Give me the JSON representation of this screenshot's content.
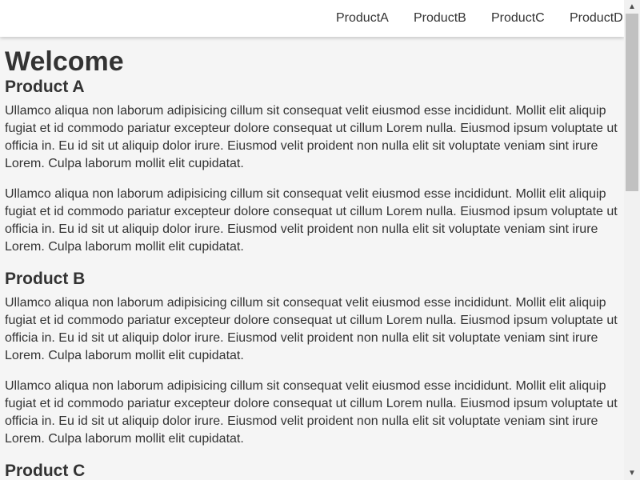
{
  "nav": {
    "links": [
      "ProductA",
      "ProductB",
      "ProductC",
      "ProductD"
    ]
  },
  "page": {
    "title": "Welcome"
  },
  "sections": [
    {
      "heading": "Product A",
      "paragraphs": [
        "Ullamco aliqua non laborum adipisicing cillum sit consequat velit eiusmod esse incididunt. Mollit elit aliquip fugiat et id commodo pariatur excepteur dolore consequat ut cillum Lorem nulla. Eiusmod ipsum voluptate ut officia in. Eu id sit ut aliquip dolor irure. Eiusmod velit proident non nulla elit sit voluptate veniam sint irure Lorem. Culpa laborum mollit elit cupidatat.",
        "Ullamco aliqua non laborum adipisicing cillum sit consequat velit eiusmod esse incididunt. Mollit elit aliquip fugiat et id commodo pariatur excepteur dolore consequat ut cillum Lorem nulla. Eiusmod ipsum voluptate ut officia in. Eu id sit ut aliquip dolor irure. Eiusmod velit proident non nulla elit sit voluptate veniam sint irure Lorem. Culpa laborum mollit elit cupidatat."
      ]
    },
    {
      "heading": "Product B",
      "paragraphs": [
        "Ullamco aliqua non laborum adipisicing cillum sit consequat velit eiusmod esse incididunt. Mollit elit aliquip fugiat et id commodo pariatur excepteur dolore consequat ut cillum Lorem nulla. Eiusmod ipsum voluptate ut officia in. Eu id sit ut aliquip dolor irure. Eiusmod velit proident non nulla elit sit voluptate veniam sint irure Lorem. Culpa laborum mollit elit cupidatat.",
        "Ullamco aliqua non laborum adipisicing cillum sit consequat velit eiusmod esse incididunt. Mollit elit aliquip fugiat et id commodo pariatur excepteur dolore consequat ut cillum Lorem nulla. Eiusmod ipsum voluptate ut officia in. Eu id sit ut aliquip dolor irure. Eiusmod velit proident non nulla elit sit voluptate veniam sint irure Lorem. Culpa laborum mollit elit cupidatat."
      ]
    },
    {
      "heading": "Product C",
      "paragraphs": []
    }
  ],
  "scrollbar": {
    "up_icon": "triangle-up-icon",
    "down_icon": "triangle-down-icon",
    "up_glyph": "▲",
    "down_glyph": "▼"
  },
  "colors": {
    "page_background": "#f5f5f5",
    "navbar_background": "#ffffff",
    "text": "#333333",
    "scroll_thumb": "#c1c1c1"
  }
}
